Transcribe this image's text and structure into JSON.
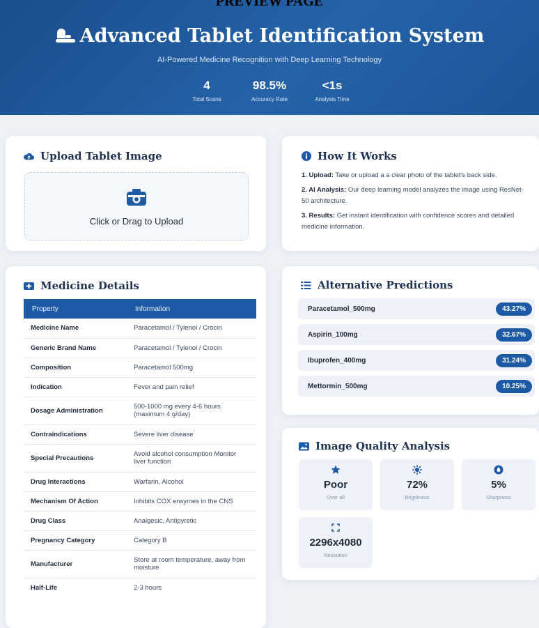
{
  "preview_label": "PREVIEW PAGE",
  "header": {
    "title": "Advanced Tablet Identification System",
    "subtitle": "AI-Powered Medicine Recognition with Deep Learning Technology",
    "stats": [
      {
        "value": "4",
        "label": "Total Scans"
      },
      {
        "value": "98.5%",
        "label": "Accuracy Rate"
      },
      {
        "value": "<1s",
        "label": "Analysis Time"
      }
    ]
  },
  "upload": {
    "title": "Upload Tablet Image",
    "prompt": "Click or Drag to Upload"
  },
  "how": {
    "title": "How It Works",
    "steps": [
      {
        "label": "1. Upload:",
        "text": "Take or upload a a clear photo of the tablet's back side."
      },
      {
        "label": "2. AI Analysis:",
        "text": "Our deep learning model analyzes the image using ResNet-50 architecture."
      },
      {
        "label": "3. Results:",
        "text": "Get instant identification with confidence scores and detailed medicine information."
      }
    ]
  },
  "details": {
    "title": "Medicine Details",
    "headers": [
      "Property",
      "Information"
    ],
    "rows": [
      {
        "property": "Medicine Name",
        "info": "Paracetamol / Tylenol / Crocin"
      },
      {
        "property": "Generic Brand Name",
        "info": "Paracetamol / Tylenol / Crocin"
      },
      {
        "property": "Composition",
        "info": "Paracetamol 500mg"
      },
      {
        "property": "Indication",
        "info": "Fever and pain relief"
      },
      {
        "property": "Dosage Administration",
        "info": "500-1000 mg every 4-6 hours (maximum 4 g/day)"
      },
      {
        "property": "Contraindications",
        "info": "Severe liver disease"
      },
      {
        "property": "Special Precautions",
        "info": "Avoid alcohol consumption Monitor liver function"
      },
      {
        "property": "Drug Interactions",
        "info": "Warfarin, Alcohol"
      },
      {
        "property": "Mechanism Of Action",
        "info": "Inhibits COX ensymes in the CNS"
      },
      {
        "property": "Drug Class",
        "info": "Analgesic, Antipyretic"
      },
      {
        "property": "Pregnancy Category",
        "info": "Category B"
      },
      {
        "property": "Manufacturer",
        "info": "Store at room temperature, away from moisture"
      },
      {
        "property": "Half-Life",
        "info": "2-3 hours"
      }
    ]
  },
  "alternatives": {
    "title": "Alternative Predictions",
    "items": [
      {
        "name": "Paracetamol_500mg",
        "score": "43.27%"
      },
      {
        "name": "Aspirin_100mg",
        "score": "32.67%"
      },
      {
        "name": "Ibuprofen_400mg",
        "score": "31.24%"
      },
      {
        "name": "Mettormin_500mg",
        "score": "10.25%"
      }
    ]
  },
  "quality": {
    "title": "Image Quality Analysis",
    "overall": {
      "value": "Poor",
      "label": "Over all"
    },
    "brightness": {
      "value": "72%",
      "label": "Brigntness"
    },
    "sharpness": {
      "value": "5%",
      "label": "Sharpness"
    },
    "resolution": {
      "value": "2296x4080",
      "label": "Resoution"
    }
  },
  "icons": {
    "title": "pills-icon",
    "upload": "cloud-upload-icon",
    "camera": "camera-icon",
    "how": "info-circle-icon",
    "details": "medical-card-icon",
    "alternatives": "list-icon",
    "quality": "image-icon",
    "overall": "star-icon",
    "brightness": "sun-icon",
    "sharpness": "drop-icon",
    "resolution": "expand-icon"
  },
  "colors": {
    "brand": "#1d5aa5",
    "header_bg": "#2563a8",
    "background": "#eef1f6"
  }
}
